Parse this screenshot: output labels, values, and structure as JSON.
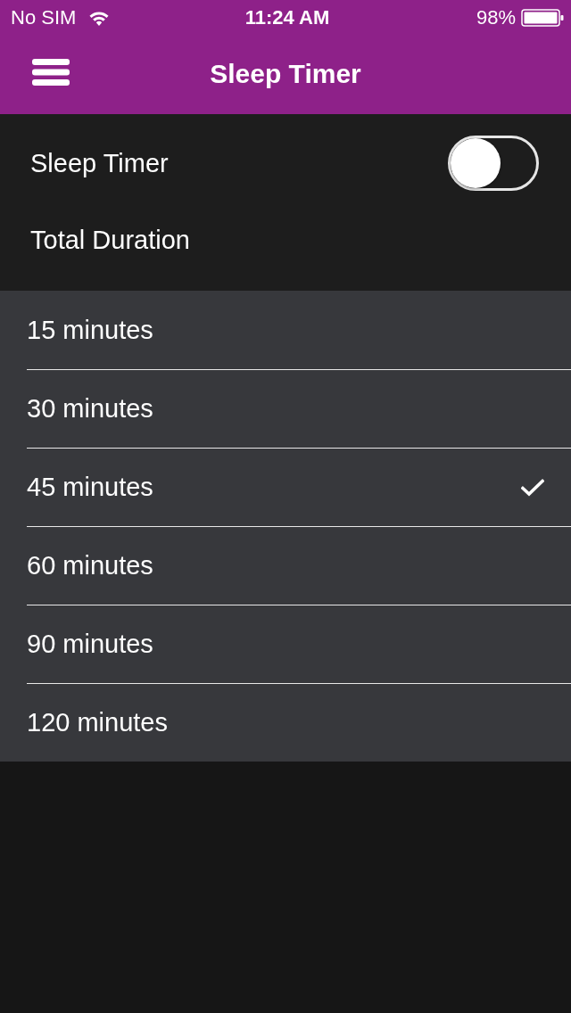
{
  "status_bar": {
    "carrier": "No SIM",
    "time": "11:24 AM",
    "battery": "98%"
  },
  "nav_bar": {
    "title": "Sleep Timer"
  },
  "settings": {
    "timer_label": "Sleep Timer",
    "timer_on": false,
    "duration_label": "Total Duration"
  },
  "durations": [
    {
      "label": "15 minutes",
      "selected": false
    },
    {
      "label": "30 minutes",
      "selected": false
    },
    {
      "label": "45 minutes",
      "selected": true
    },
    {
      "label": "60 minutes",
      "selected": false
    },
    {
      "label": "90 minutes",
      "selected": false
    },
    {
      "label": "120 minutes",
      "selected": false
    }
  ]
}
